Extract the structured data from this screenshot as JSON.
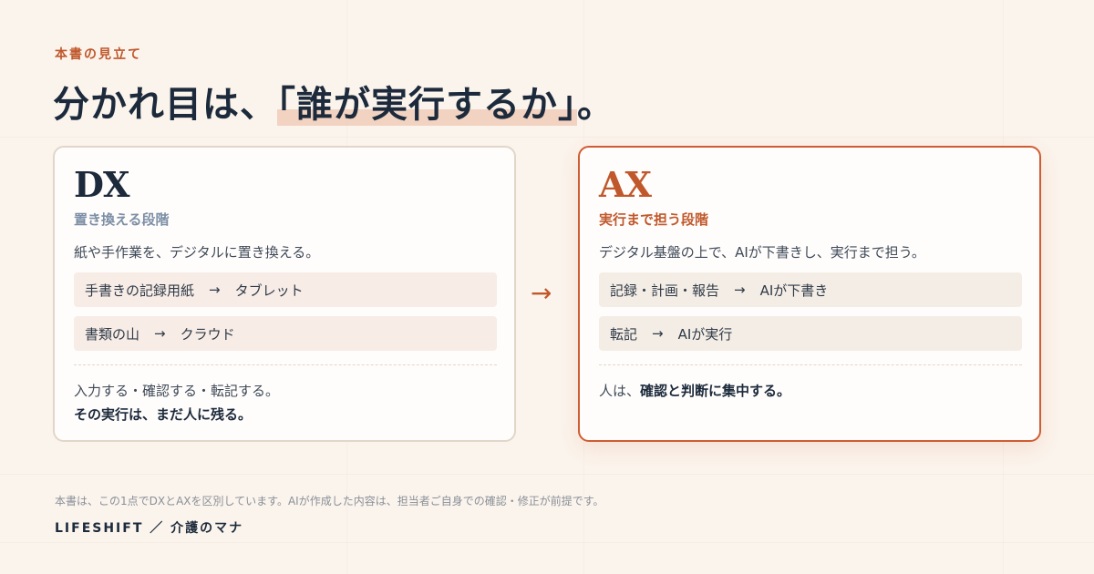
{
  "eyebrow": "本書の見立て",
  "headline": {
    "before": "分かれ目は、",
    "highlight": "「誰が実行するか」",
    "after": "。"
  },
  "dx": {
    "title": "DX",
    "subtitle": "置き換える段階",
    "description": "紙や手作業を、デジタルに置き換える。",
    "rows": [
      {
        "from": "手書きの記録用紙",
        "arrow": "→",
        "to": "タブレット"
      },
      {
        "from": "書類の山",
        "arrow": "→",
        "to": "クラウド"
      }
    ],
    "footer_line1": "入力する・確認する・転記する。",
    "footer_line2": "その実行は、まだ人に残る。"
  },
  "connector_arrow": "→",
  "ax": {
    "title": "AX",
    "subtitle": "実行まで担う段階",
    "description": "デジタル基盤の上で、AIが下書きし、実行まで担う。",
    "rows": [
      {
        "from": "記録・計画・報告",
        "arrow": "→",
        "to": "AIが下書き"
      },
      {
        "from": "転記",
        "arrow": "→",
        "to": "AIが実行"
      }
    ],
    "footer_prefix": "人は、",
    "footer_bold": "確認と判断に集中する。"
  },
  "note": "本書は、この1点でDXとAXを区別しています。AIが作成した内容は、担当者ご自身での確認・修正が前提です。",
  "brand": "LIFESHIFT ／ 介護のマナ",
  "colors": {
    "accent": "#c0582c",
    "navy": "#1c2a3c",
    "background": "#fbf4ec"
  }
}
